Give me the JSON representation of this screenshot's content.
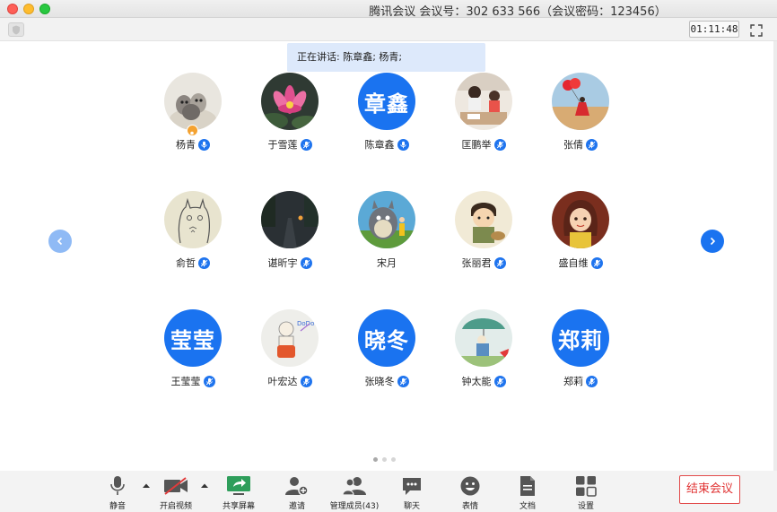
{
  "window": {
    "title": "腾讯会议 会议号：302 633 566（会议密码：123456）"
  },
  "infobar": {
    "timer": "01:11:48"
  },
  "speaking": {
    "text": "正在讲话: 陈章鑫; 杨青;"
  },
  "participants": [
    {
      "name": "杨青",
      "avatar_text": "",
      "avatar_type": "photo-cat",
      "host": true
    },
    {
      "name": "于雪莲",
      "avatar_text": "",
      "avatar_type": "photo-lotus",
      "host": false
    },
    {
      "name": "陈章鑫",
      "avatar_text": "章鑫",
      "avatar_type": "text",
      "host": false
    },
    {
      "name": "匡鹏举",
      "avatar_text": "",
      "avatar_type": "photo-study",
      "host": false
    },
    {
      "name": "张倩",
      "avatar_text": "",
      "avatar_type": "photo-balloon",
      "host": false
    },
    {
      "name": "俞哲",
      "avatar_text": "",
      "avatar_type": "drawing-totoro",
      "host": false
    },
    {
      "name": "谌昕宇",
      "avatar_text": "",
      "avatar_type": "photo-road",
      "host": false
    },
    {
      "name": "宋月",
      "avatar_text": "",
      "avatar_type": "illustration-totoro",
      "host": false
    },
    {
      "name": "张丽君",
      "avatar_text": "",
      "avatar_type": "cartoon-boy",
      "host": false
    },
    {
      "name": "盛自维",
      "avatar_text": "",
      "avatar_type": "cartoon-girl",
      "host": false
    },
    {
      "name": "王莹莹",
      "avatar_text": "莹莹",
      "avatar_type": "text",
      "host": false
    },
    {
      "name": "叶宏达",
      "avatar_text": "",
      "avatar_type": "cartoon-doodle",
      "host": false
    },
    {
      "name": "张晓冬",
      "avatar_text": "晓冬",
      "avatar_type": "text",
      "host": false
    },
    {
      "name": "钟太能",
      "avatar_text": "",
      "avatar_type": "illustration-umbrella",
      "host": false
    },
    {
      "name": "郑莉",
      "avatar_text": "郑莉",
      "avatar_type": "text",
      "host": false
    }
  ],
  "pagination": {
    "pages": 3,
    "current": 1
  },
  "toolbar": {
    "mute": "静音",
    "video": "开启视频",
    "share": "共享屏幕",
    "invite": "邀请",
    "members": "管理成员(43)",
    "chat": "聊天",
    "emoji": "表情",
    "docs": "文档",
    "settings": "设置",
    "end": "结束会议"
  },
  "colors": {
    "accent": "#1a73f0",
    "share_green": "#2e9e5b",
    "end_red": "#e03232",
    "host_badge": "#f4a230"
  }
}
